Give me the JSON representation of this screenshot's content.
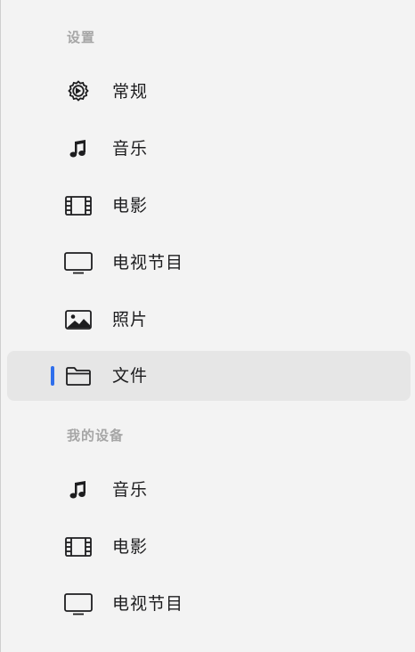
{
  "sections": [
    {
      "title": "设置",
      "items": [
        {
          "label": "常规",
          "icon": "gear-icon"
        },
        {
          "label": "音乐",
          "icon": "music-note-icon"
        },
        {
          "label": "电影",
          "icon": "film-icon"
        },
        {
          "label": "电视节目",
          "icon": "tv-icon"
        },
        {
          "label": "照片",
          "icon": "photo-icon"
        },
        {
          "label": "文件",
          "icon": "folder-icon",
          "selected": true
        }
      ]
    },
    {
      "title": "我的设备",
      "items": [
        {
          "label": "音乐",
          "icon": "music-note-icon"
        },
        {
          "label": "电影",
          "icon": "film-icon"
        },
        {
          "label": "电视节目",
          "icon": "tv-icon"
        }
      ]
    }
  ],
  "colors": {
    "accent": "#2f6fec",
    "section_header": "#a6a6a6",
    "text": "#1d1d1f",
    "background": "#f3f3f3",
    "selected_background": "#e6e6e6"
  }
}
